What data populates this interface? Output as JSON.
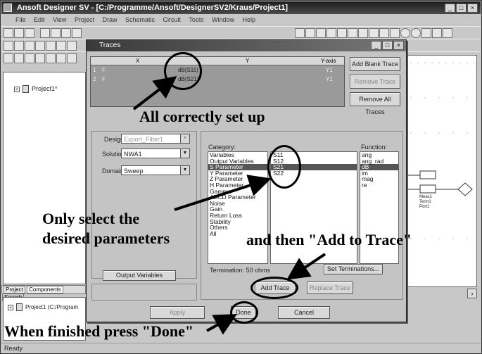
{
  "app": {
    "title": "Ansoft Designer SV - [C:/Programme/Ansoft/DesignerSV2/Kraus/Project1]",
    "menu": [
      "File",
      "Edit",
      "View",
      "Project",
      "Draw",
      "Schematic",
      "Circuit",
      "Tools",
      "Window",
      "Help"
    ],
    "status": "Ready"
  },
  "project_tree": {
    "item_top": "Project1*",
    "tabs": [
      "Project",
      "Components",
      "Search"
    ],
    "item_bottom": "Project1 (C:/Program"
  },
  "dialog": {
    "title": "Traces",
    "table": {
      "headers": [
        "X",
        "Y",
        "Y-axis"
      ],
      "rows": [
        {
          "num": "1",
          "x": "F",
          "y": "dB(S11)",
          "axis": "Y1"
        },
        {
          "num": "2",
          "x": "F",
          "y": "dB(S21)",
          "axis": "Y1"
        }
      ]
    },
    "buttons": {
      "add_blank": "Add Blank Trace",
      "remove": "Remove Trace",
      "remove_all": "Remove All Traces",
      "output_vars": "Output Variables",
      "set_terminations": "Set Terminations...",
      "add_trace": "Add Trace",
      "replace_trace": "Replace Trace",
      "apply": "Apply",
      "done": "Done",
      "cancel": "Cancel"
    },
    "design_label": "Design:",
    "design_value": "Export_Filter1",
    "solution_label": "Solution:",
    "solution_value": "NWA1",
    "domain_label": "Domain:",
    "domain_value": "Sweep",
    "category_label": "Category:",
    "categories": [
      "Variables",
      "Output Variables",
      "S Parameter",
      "Y Parameter",
      "Z Parameter",
      "H Parameter",
      "Gamma",
      "ABCD Parameter",
      "Noise",
      "Gain",
      "Return Loss",
      "Stability",
      "Others",
      "All"
    ],
    "selected_category": "S Parameter",
    "quantities": [
      "S11",
      "S12",
      "S21",
      "S22"
    ],
    "selected_quantity": "S21",
    "function_label": "Function:",
    "functions": [
      "ang",
      "ang_rad",
      "dB",
      "im",
      "mag",
      "re"
    ],
    "selected_function": "dB",
    "termination": "Termination:  50 ohms"
  },
  "schematic_labels": [
    "Meas1",
    "Term1",
    "Port1"
  ],
  "annotations": {
    "setup": "All correctly set up",
    "select1": "Only select the",
    "select2": "desired parameters",
    "add": "and then \"Add to Trace\"",
    "done": "When finished press \"Done\""
  }
}
